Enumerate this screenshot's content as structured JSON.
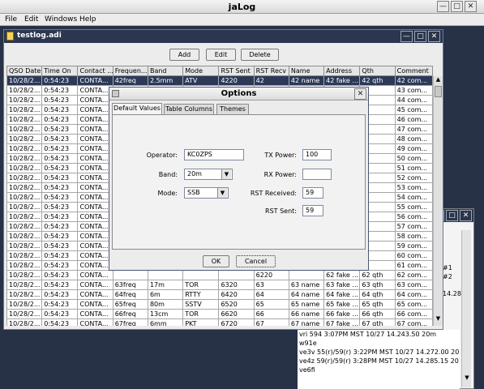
{
  "app": {
    "title": "jaLog"
  },
  "menubar": [
    "File",
    "Edit",
    "Windows",
    "Help"
  ],
  "logwin": {
    "title": "testlog.adi",
    "buttons": {
      "add": "Add",
      "edit": "Edit",
      "delete": "Delete"
    },
    "columns": [
      "QSO Date",
      "Time On",
      "Contact ...",
      "Frequen...",
      "Band",
      "Mode",
      "RST Sent",
      "RST Recv",
      "Name",
      "Address",
      "Qth",
      "Comment"
    ],
    "rows": [
      [
        "10/28/2...",
        "0:54:23",
        "CONTA...",
        "42freq",
        "2.5mm",
        "ATV",
        "4220",
        "42",
        "42 name",
        "42 fake ...",
        "42 qth",
        "42 com..."
      ],
      [
        "10/28/2...",
        "0:54:23",
        "CONTA...",
        "",
        "",
        "",
        "",
        "",
        "",
        "",
        "",
        "43 com..."
      ],
      [
        "10/28/2...",
        "0:54:23",
        "CONTA...",
        "",
        "",
        "",
        "",
        "",
        "",
        "",
        "",
        "44 com..."
      ],
      [
        "10/28/2...",
        "0:54:23",
        "CONTA...",
        "",
        "",
        "",
        "",
        "",
        "",
        "",
        "",
        "45 com..."
      ],
      [
        "10/28/2...",
        "0:54:23",
        "CONTA...",
        "",
        "",
        "",
        "",
        "",
        "",
        "",
        "",
        "46 com..."
      ],
      [
        "10/28/2...",
        "0:54:23",
        "CONTA...",
        "",
        "",
        "",
        "",
        "",
        "",
        "",
        "",
        "47 com..."
      ],
      [
        "10/28/2...",
        "0:54:23",
        "CONTA...",
        "",
        "",
        "",
        "",
        "",
        "",
        "",
        "",
        "48 com..."
      ],
      [
        "10/28/2...",
        "0:54:23",
        "CONTA...",
        "",
        "",
        "",
        "",
        "",
        "",
        "",
        "",
        "49 com..."
      ],
      [
        "10/28/2...",
        "0:54:23",
        "CONTA...",
        "",
        "",
        "",
        "",
        "",
        "",
        "",
        "",
        "50 com..."
      ],
      [
        "10/28/2...",
        "0:54:23",
        "CONTA...",
        "",
        "",
        "",
        "",
        "",
        "",
        "",
        "",
        "51 com..."
      ],
      [
        "10/28/2...",
        "0:54:23",
        "CONTA...",
        "",
        "",
        "",
        "",
        "",
        "",
        "",
        "",
        "52 com..."
      ],
      [
        "10/28/2...",
        "0:54:23",
        "CONTA...",
        "",
        "",
        "",
        "",
        "",
        "",
        "",
        "",
        "53 com..."
      ],
      [
        "10/28/2...",
        "0:54:23",
        "CONTA...",
        "",
        "",
        "",
        "",
        "",
        "",
        "",
        "",
        "54 com..."
      ],
      [
        "10/28/2...",
        "0:54:23",
        "CONTA...",
        "",
        "",
        "",
        "",
        "",
        "",
        "",
        "",
        "55 com..."
      ],
      [
        "10/28/2...",
        "0:54:23",
        "CONTA...",
        "",
        "",
        "",
        "",
        "",
        "",
        "",
        "",
        "56 com..."
      ],
      [
        "10/28/2...",
        "0:54:23",
        "CONTA...",
        "",
        "",
        "",
        "",
        "",
        "",
        "",
        "",
        "57 com..."
      ],
      [
        "10/28/2...",
        "0:54:23",
        "CONTA...",
        "",
        "",
        "",
        "",
        "",
        "",
        "",
        "",
        "58 com..."
      ],
      [
        "10/28/2...",
        "0:54:23",
        "CONTA...",
        "",
        "",
        "",
        "",
        "",
        "",
        "",
        "",
        "59 com..."
      ],
      [
        "10/28/2...",
        "0:54:23",
        "CONTA...",
        "",
        "",
        "",
        "",
        "",
        "",
        "",
        "",
        "60 com..."
      ],
      [
        "10/28/2...",
        "0:54:23",
        "CONTA...",
        "",
        "",
        "",
        "",
        "",
        "",
        "",
        "",
        "61 com..."
      ],
      [
        "10/28/2...",
        "0:54:23",
        "CONTA...",
        "",
        "",
        "",
        "",
        "6220",
        "",
        "62 fake ...",
        "62 qth",
        "62 com..."
      ],
      [
        "10/28/2...",
        "0:54:23",
        "CONTA...",
        "63freq",
        "17m",
        "TOR",
        "6320",
        "63",
        "63 name",
        "63 fake ...",
        "63 qth",
        "63 com..."
      ],
      [
        "10/28/2...",
        "0:54:23",
        "CONTA...",
        "64freq",
        "6m",
        "RTTY",
        "6420",
        "64",
        "64 name",
        "64 fake ...",
        "64 qth",
        "64 com..."
      ],
      [
        "10/28/2...",
        "0:54:23",
        "CONTA...",
        "65freq",
        "80m",
        "SSTV",
        "6520",
        "65",
        "65 name",
        "65 fake ...",
        "65 qth",
        "65 com..."
      ],
      [
        "10/28/2...",
        "0:54:23",
        "CONTA...",
        "66freq",
        "13cm",
        "TOR",
        "6620",
        "66",
        "66 name",
        "66 fake ...",
        "66 qth",
        "66 com..."
      ],
      [
        "10/28/2...",
        "0:54:23",
        "CONTA...",
        "67freq",
        "6mm",
        "PKT",
        "6720",
        "67",
        "67 name",
        "67 fake ...",
        "67 qth",
        "67 com..."
      ]
    ]
  },
  "dialog": {
    "title": "Options",
    "tabs": [
      "Default Values",
      "Table Columns",
      "Themes"
    ],
    "operator": {
      "label": "Operator:",
      "value": "KC0ZPS"
    },
    "band": {
      "label": "Band:",
      "value": "20m"
    },
    "mode": {
      "label": "Mode:",
      "value": "SSB"
    },
    "tx_power": {
      "label": "TX Power:",
      "value": "100"
    },
    "rx_power": {
      "label": "RX Power:",
      "value": ""
    },
    "rst_received": {
      "label": "RST Received:",
      "value": "59"
    },
    "rst_sent": {
      "label": "RST Sent:",
      "value": "59"
    },
    "ok": "OK",
    "cancel": "Cancel"
  },
  "cluster": {
    "partial": [
      "#1",
      "#2",
      "14.28"
    ],
    "lines": [
      "vri 594 3:07PM MST 10/27    14.243.50 20m",
      "w91e",
      "ve3v 55(r)/59(r) 3:22PM MST 10/27 14.272.00 20",
      "ve4z 59(r)/59(r) 3:28PM MST 10/27 14.285.15 20",
      "ve6fi"
    ]
  }
}
